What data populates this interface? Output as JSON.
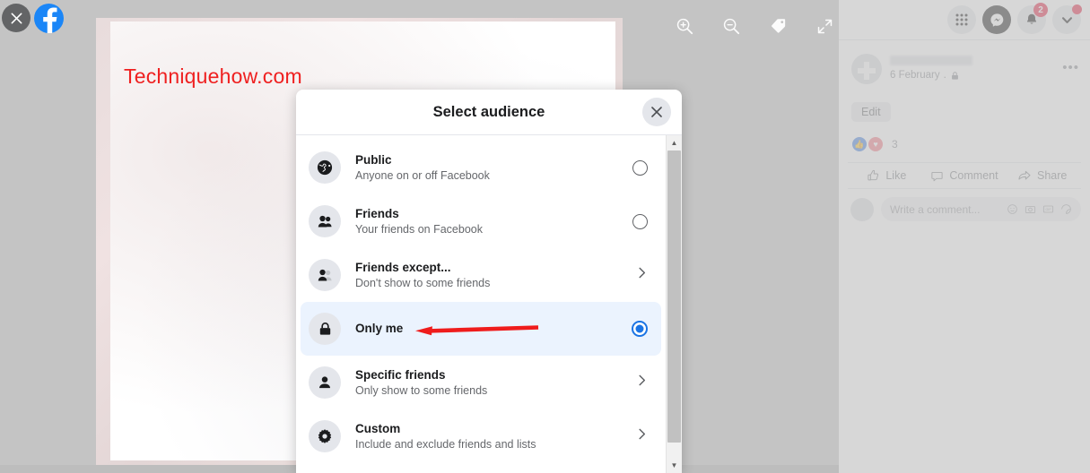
{
  "viewer": {
    "watermark": "Techniquehow.com",
    "close_icon": "close-x-icon",
    "brand_icon": "facebook-logo-icon",
    "toolbar": [
      {
        "name": "zoom-in-icon",
        "label": "Zoom in"
      },
      {
        "name": "zoom-out-icon",
        "label": "Zoom out"
      },
      {
        "name": "tag-icon",
        "label": "Tag photo"
      },
      {
        "name": "fullscreen-icon",
        "label": "Enter fullscreen"
      }
    ]
  },
  "modal": {
    "title": "Select audience",
    "close_label": "Close",
    "scrollbar": {
      "up": "▲",
      "down": "▼"
    },
    "options": [
      {
        "icon": "globe-icon",
        "title": "Public",
        "subtitle": "Anyone on or off Facebook",
        "control": "radio",
        "selected": false
      },
      {
        "icon": "friends-icon",
        "title": "Friends",
        "subtitle": "Your friends on Facebook",
        "control": "radio",
        "selected": false
      },
      {
        "icon": "friends-except-icon",
        "title": "Friends except...",
        "subtitle": "Don't show to some friends",
        "control": "chevron",
        "selected": false
      },
      {
        "icon": "lock-icon",
        "title": "Only me",
        "subtitle": "",
        "control": "radio",
        "selected": true
      },
      {
        "icon": "person-icon",
        "title": "Specific friends",
        "subtitle": "Only show to some friends",
        "control": "chevron",
        "selected": false
      },
      {
        "icon": "gear-icon",
        "title": "Custom",
        "subtitle": "Include and exclude friends and lists",
        "control": "chevron",
        "selected": false
      }
    ]
  },
  "sidepanel": {
    "topbar": [
      {
        "name": "grid-menu-icon",
        "badge": ""
      },
      {
        "name": "messenger-icon",
        "badge": ""
      },
      {
        "name": "notifications-bell-icon",
        "badge": "2"
      },
      {
        "name": "account-chevron-icon",
        "badge": ""
      }
    ],
    "post": {
      "author_name": "",
      "date": "6 February",
      "privacy_icon": "lock-icon",
      "separator": ".",
      "more_label": "•••",
      "edit_label": "Edit",
      "reaction_count": "3",
      "reactions": [
        "like-icon",
        "love-icon"
      ],
      "actions": [
        {
          "icon": "thumbs-up-icon",
          "label": "Like"
        },
        {
          "icon": "comment-bubble-icon",
          "label": "Comment"
        },
        {
          "icon": "share-arrow-icon",
          "label": "Share"
        }
      ],
      "comment_placeholder": "Write a comment...",
      "comment_icons": [
        "emoji-icon",
        "camera-icon",
        "gif-icon",
        "sticker-icon"
      ]
    }
  },
  "annotation": {
    "arrow_color": "#ef1c1c",
    "points_to": "Only me"
  },
  "colors": {
    "accent_blue": "#1b74e4",
    "selected_row_bg": "#ebf3fe",
    "watermark_red": "#ef2020",
    "badge_red": "#e41e3f"
  }
}
